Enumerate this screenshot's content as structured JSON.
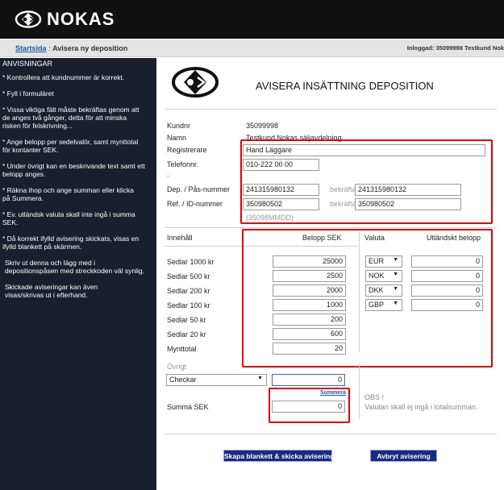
{
  "header": {
    "brand": "NOKAS"
  },
  "crumbbar": {
    "home_link": "Startsida",
    "separator": ":",
    "current": "Avisera ny deposition",
    "login": "Inloggad: 35099998 Testkund Nok"
  },
  "sidebar": {
    "title": "ANVISNINGAR",
    "items": [
      "* Kontrollera att kundnummer är korrekt.",
      "* Fyll i formuläret",
      "* Vissa viktiga fält måste bekräftas genom att de anges två gånger, detta för att minska risken för felskrivning...",
      "* Ange belopp per sedelvalör, samt mynttotal för kontanter SEK.",
      "* Under övrigt kan en beskrivande text samt ett belopp anges.",
      "* Räkna ihop och ange summan eller klicka på Summera.",
      "* Ev. utländsk valuta skall inte ingå i summa SEK.",
      "* Då korrekt ifylld avisering skickats, visas en ifylld blankett på skärmen.",
      "Skriv ut denna och lägg med i depositionspåsen med streckkoden väl synlig.",
      "Skickade aviseringar kan även visas/skrivas ut i efterhand."
    ]
  },
  "form": {
    "title": "AVISERA INSÄTTNING DEPOSITION",
    "kundnr_label": "Kundnr",
    "kundnr_value": "35099998",
    "namn_label": "Namn",
    "namn_value": "Testkund Nokas säljavdelning",
    "registrerare_label": "Registrerare",
    "registrerare_value": "Hand Läggare",
    "telefon_label": "Telefonnr.",
    "telefon_value": "010-222 00 00",
    "dot": ".",
    "dep_label": "Dep. / Pås-nummer",
    "dep_value": "241315980132",
    "dep_confirm_label": "bekräfta",
    "dep_confirm_value": "241315980132",
    "ref_label": "Ref. / ID-nummer",
    "ref_value": "350980502",
    "ref_confirm_label": "bekräfta",
    "ref_confirm_value": "350980502",
    "ref_hint": "(35098MMDD)"
  },
  "amounts": {
    "col_innehall": "Innehåll",
    "col_belopp": "Belopp SEK",
    "col_valuta": "Valuta",
    "col_utlandskt": "Utländskt belopp",
    "rows": [
      {
        "label": "Sedlar 1000 kr",
        "value": "25000"
      },
      {
        "label": "Sedlar 500 kr",
        "value": "2500"
      },
      {
        "label": "Sedlar 200 kr",
        "value": "2000"
      },
      {
        "label": "Sedlar 100 kr",
        "value": "1000"
      },
      {
        "label": "Sedlar 50 kr",
        "value": "200"
      },
      {
        "label": "Sedlar 20 kr",
        "value": "600"
      },
      {
        "label": "Mynttotal",
        "value": "20"
      }
    ],
    "currencies": [
      {
        "code": "EUR",
        "amount": "0"
      },
      {
        "code": "NOK",
        "amount": "0"
      },
      {
        "code": "DKK",
        "amount": "0"
      },
      {
        "code": "GBP",
        "amount": "0"
      }
    ],
    "select_arrow": "▼"
  },
  "ovrigt": {
    "label": "Övrigt",
    "select_value": "Checkar",
    "amount": "0",
    "summera": "Summera",
    "summa_label": "Summa SEK",
    "summa_value": "0",
    "obs_title": "OBS !",
    "obs_text": "Valutan skall ej ingå i totalsumman."
  },
  "buttons": {
    "submit": "Skapa blankett & skicka avisering",
    "cancel": "Avbryt avisering"
  },
  "colors": {
    "highlight": "#e00000",
    "sidebar_bg": "#1a1f2e",
    "button_bg": "#1a2a80",
    "link": "#2255aa"
  }
}
